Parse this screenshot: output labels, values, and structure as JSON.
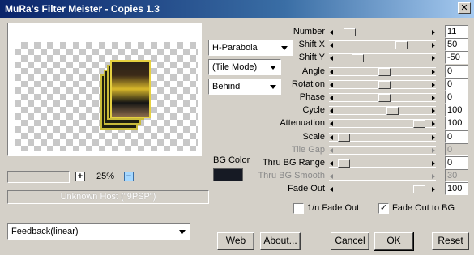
{
  "window": {
    "title": "MuRa's Filter Meister - Copies 1.3",
    "close_glyph": "✕"
  },
  "zoom": {
    "value": "25%",
    "plus": "+",
    "minus": "−"
  },
  "host_status": "Unknown Host (\"9PSP\")",
  "combos": {
    "mode": "H-Parabola",
    "tile": "(Tile Mode)",
    "order": "Behind",
    "feedback": "Feedback(linear)"
  },
  "bg_color": {
    "label": "BG Color",
    "swatch": "#161a24"
  },
  "sliders": [
    {
      "label": "Number",
      "value": "11",
      "level": 0.11,
      "disabled": false
    },
    {
      "label": "Shift X",
      "value": "50",
      "level": 0.7,
      "disabled": false
    },
    {
      "label": "Shift Y",
      "value": "-50",
      "level": 0.2,
      "disabled": false
    },
    {
      "label": "Angle",
      "value": "0",
      "level": 0.5,
      "disabled": false
    },
    {
      "label": "Rotation",
      "value": "0",
      "level": 0.5,
      "disabled": false
    },
    {
      "label": "Phase",
      "value": "0",
      "level": 0.5,
      "disabled": false
    },
    {
      "label": "Cycle",
      "value": "100",
      "level": 0.6,
      "disabled": false
    },
    {
      "label": "Attenuation",
      "value": "100",
      "level": 0.9,
      "disabled": false
    },
    {
      "label": "Scale",
      "value": "0",
      "level": 0.05,
      "disabled": false
    },
    {
      "label": "Tile Gap",
      "value": "0",
      "level": null,
      "disabled": true
    },
    {
      "label": "Thru BG Range",
      "value": "0",
      "level": 0.05,
      "disabled": false
    },
    {
      "label": "Thru BG Smooth",
      "value": "30",
      "level": null,
      "disabled": true
    },
    {
      "label": "Fade Out",
      "value": "100",
      "level": 0.9,
      "disabled": false
    }
  ],
  "checkboxes": {
    "fade_n": {
      "label": "1/n Fade Out",
      "checked": false,
      "mark": ""
    },
    "fade_bg": {
      "label": "Fade Out to BG",
      "checked": true,
      "mark": "✓"
    }
  },
  "buttons": {
    "web": "Web",
    "about": "About...",
    "cancel": "Cancel",
    "ok": "OK",
    "reset": "Reset"
  }
}
